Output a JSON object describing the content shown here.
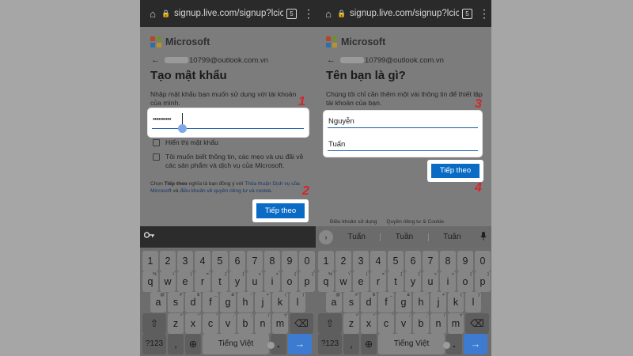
{
  "browser": {
    "url": "signup.live.com/signup?lcic",
    "tab_count": "5"
  },
  "brand": {
    "name": "Microsoft",
    "logo_colors": [
      "#b5462b",
      "#6f8f2f",
      "#2f6fa8",
      "#b8922e"
    ]
  },
  "left": {
    "email": "10799@outlook.com.vn",
    "title": "Tạo mật khẩu",
    "description": "Nhập mật khẩu bạn muốn sử dụng với tài khoản của mình.",
    "password_value": "••••••••••",
    "show_password_label": "Hiển thị mật khẩu",
    "marketing_label": "Tôi muốn biết thông tin, các mẹo và ưu đãi về các sản phẩm và dịch vụ của Microsoft.",
    "legal": {
      "part1": "Chọn ",
      "bold": "Tiếp theo",
      "part2": " nghĩa là bạn đồng ý với ",
      "link1": "Thỏa thuận Dịch vụ của Microsoft",
      "part3": " và ",
      "link2": "điều khoản về quyền riêng tư và cookie",
      "part4": "."
    },
    "next_button": "Tiếp theo",
    "badge_field": "1",
    "badge_button": "2"
  },
  "right": {
    "email": "10799@outlook.com.vn",
    "title": "Tên bạn là gì?",
    "description": "Chúng tôi chỉ cần thêm một vài thông tin để thiết lập tài khoản của bạn.",
    "last_name_value": "Nguyễn",
    "first_name_value": "Tuấn",
    "next_button": "Tiếp theo",
    "badge_fields": "3",
    "badge_button": "4",
    "footer_terms": "Điều khoản sử dụng",
    "footer_privacy": "Quyền riêng tư & Cookie",
    "suggestions": [
      "Tuấn",
      "Tuần",
      "Tuân"
    ]
  },
  "keyboard": {
    "numbers": [
      "1",
      "2",
      "3",
      "4",
      "5",
      "6",
      "7",
      "8",
      "9",
      "0"
    ],
    "row1": [
      "q",
      "w",
      "e",
      "r",
      "t",
      "y",
      "u",
      "i",
      "o",
      "p"
    ],
    "row1_sup": [
      "%",
      "\\",
      "|",
      "=",
      "[",
      "]",
      "<",
      ">",
      "{",
      "}"
    ],
    "row2": [
      "a",
      "s",
      "d",
      "f",
      "g",
      "h",
      "j",
      "k",
      "l"
    ],
    "row2_sup": [
      "@",
      "#",
      "$",
      "_",
      "&",
      "-",
      "+",
      "(",
      ")"
    ],
    "row3": [
      "z",
      "x",
      "c",
      "v",
      "b",
      "n",
      "m"
    ],
    "row3_sup": [
      "*",
      "\"",
      "'",
      ":",
      ";",
      "!",
      "?"
    ],
    "symbols_key": "?123",
    "comma_key": ",",
    "space_label": "Tiếng Việt",
    "period_key": ".",
    "enter_glyph": "→",
    "shift_glyph": "⇧",
    "backspace_glyph": "⌫",
    "globe_glyph": "⊕"
  },
  "colors": {
    "accent": "#0a6bc5",
    "badge": "#d4262a",
    "field_underline": "#1a5fa8"
  }
}
